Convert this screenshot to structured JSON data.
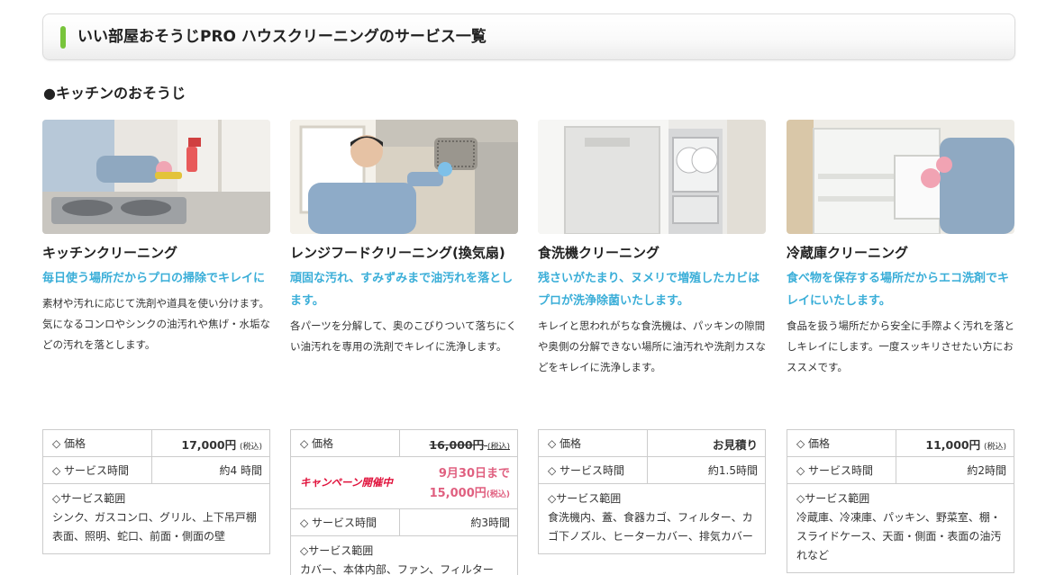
{
  "page": {
    "title": "いい部屋おそうじPRO ハウスクリーニングのサービス一覧"
  },
  "section": {
    "title": "●キッチンのおそうじ"
  },
  "colors": {
    "accent_green": "#78c43b",
    "catch_blue": "#3aaed8",
    "campaign_pink": "#e06080"
  },
  "cards": [
    {
      "name": "キッチンクリーニング",
      "catch": "毎日使う場所だからプロの掃除でキレイに",
      "desc": "素材や汚れに応じて洗剤や道具を使い分けます。気になるコンロやシンクの油汚れや焦げ・水垢などの汚れを落とします。",
      "price_label": "◇ 価格",
      "price": "17,000円",
      "tax": "(税込)",
      "time_label": "◇ サービス時間",
      "time": "約4 時間",
      "scope_label": "◇サービス範囲",
      "scope": "シンク、ガスコンロ、グリル、上下吊戸棚表面、照明、蛇口、前面・側面の壁"
    },
    {
      "name": "レンジフードクリーニング(換気扇)",
      "catch": "頑固な汚れ、すみずみまで油汚れを落とします。",
      "desc": "各パーツを分解して、奥のこびりついて落ちにくい油汚れを専用の洗剤でキレイに洗浄します。",
      "price_label": "◇ 価格",
      "price": "16,000円",
      "tax": "(税込)",
      "campaign_badge": "キャンペーン開催中",
      "campaign_until": "9月30日まで",
      "campaign_price": "15,000円",
      "campaign_tax": "(税込)",
      "time_label": "◇ サービス時間",
      "time": "約3時間",
      "scope_label": "◇サービス範囲",
      "scope": "カバー、本体内部、ファン、フィルター"
    },
    {
      "name": "食洗機クリーニング",
      "catch": "残さいがたまり、ヌメリで増殖したカビはプロが洗浄除菌いたします。",
      "desc": "キレイと思われがちな食洗機は、パッキンの隙間や奥側の分解できない場所に油汚れや洗剤カスなどをキレイに洗浄します。",
      "price_label": "◇ 価格",
      "price": "お見積り",
      "time_label": "◇ サービス時間",
      "time": "約1.5時間",
      "scope_label": "◇サービス範囲",
      "scope": "食洗機内、蓋、食器カゴ、フィルター、カゴ下ノズル、ヒーターカバー、排気カバー"
    },
    {
      "name": "冷蔵庫クリーニング",
      "catch": "食べ物を保存する場所だからエコ洗剤でキレイにいたします。",
      "desc": "食品を扱う場所だから安全に手際よく汚れを落としキレイにします。一度スッキリさせたい方におススメです。",
      "price_label": "◇ 価格",
      "price": "11,000円",
      "tax": "(税込)",
      "time_label": "◇ サービス時間",
      "time": "約2時間",
      "scope_label": "◇サービス範囲",
      "scope": "冷蔵庫、冷凍庫、パッキン、野菜室、棚・スライドケース、天面・側面・表面の油汚れなど"
    }
  ]
}
